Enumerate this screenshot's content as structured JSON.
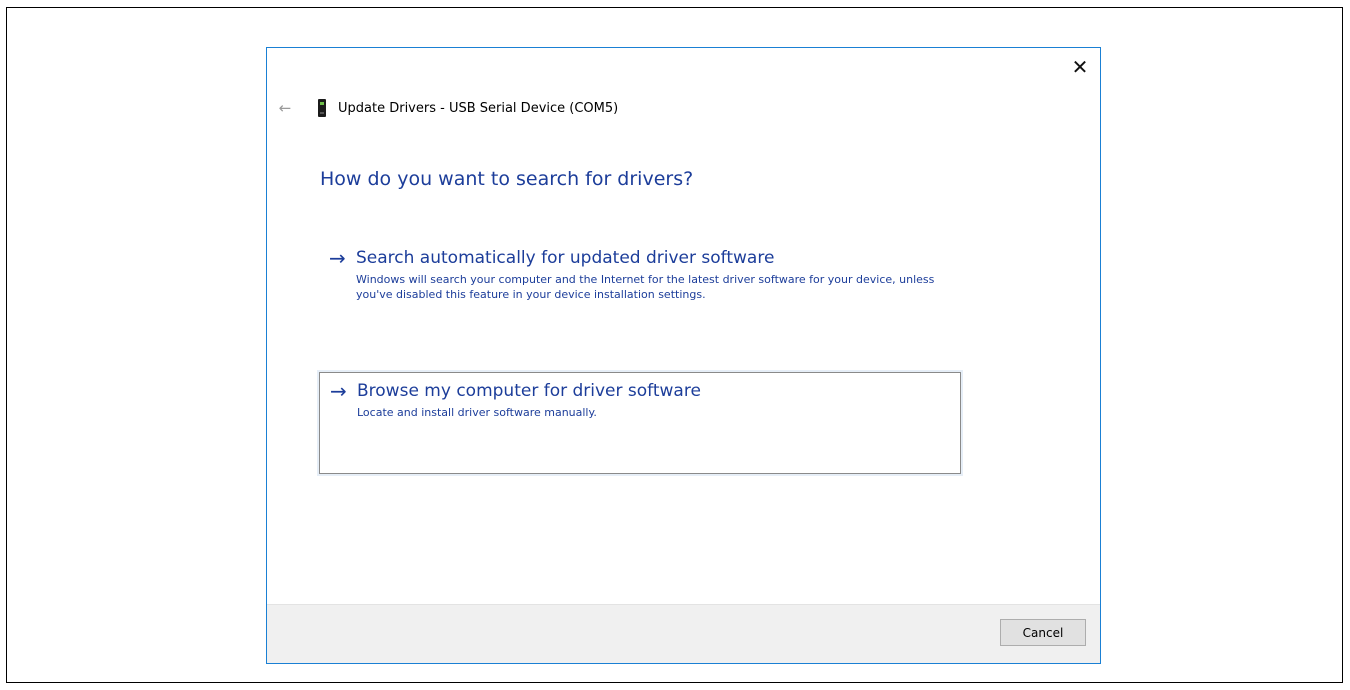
{
  "dialog": {
    "title": "Update Drivers - USB Serial Device (COM5)",
    "question": "How do you want to search for drivers?",
    "close_glyph": "✕",
    "back_glyph": "←",
    "accent_color": "#1a80d4",
    "link_color": "#1c3d9a"
  },
  "options": [
    {
      "arrow": "→",
      "heading": "Search automatically for updated driver software",
      "description": "Windows will search your computer and the Internet for the latest driver software for your device, unless you've disabled this feature in your device installation settings."
    },
    {
      "arrow": "→",
      "heading": "Browse my computer for driver software",
      "description": "Locate and install driver software manually."
    }
  ],
  "footer": {
    "cancel_label": "Cancel"
  },
  "icons": {
    "device": "usb-device-icon",
    "back": "back-arrow-icon",
    "close": "close-icon",
    "option_arrow": "arrow-right-icon"
  }
}
